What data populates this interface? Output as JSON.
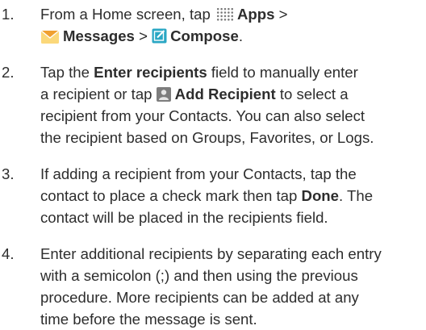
{
  "steps": [
    {
      "number": "1.",
      "lines": [
        [
          {
            "t": "text",
            "v": "From a Home screen, tap "
          },
          {
            "t": "icon",
            "icon": "apps-grid-icon"
          },
          {
            "t": "bold",
            "v": "Apps"
          },
          {
            "t": "text",
            "v": " >"
          }
        ],
        [
          {
            "t": "icon",
            "icon": "messages-envelope-icon"
          },
          {
            "t": "bold",
            "v": "Messages"
          },
          {
            "t": "text",
            "v": " > "
          },
          {
            "t": "icon",
            "icon": "compose-icon"
          },
          {
            "t": "bold",
            "v": "Compose"
          },
          {
            "t": "text",
            "v": "."
          }
        ]
      ]
    },
    {
      "number": "2.",
      "lines": [
        [
          {
            "t": "text",
            "v": "Tap the "
          },
          {
            "t": "bold",
            "v": "Enter recipients"
          },
          {
            "t": "text",
            "v": " field to manually enter"
          }
        ],
        [
          {
            "t": "text",
            "v": "a recipient or tap "
          },
          {
            "t": "icon",
            "icon": "add-recipient-icon"
          },
          {
            "t": "bold",
            "v": "Add Recipient"
          },
          {
            "t": "text",
            "v": " to select a"
          }
        ],
        [
          {
            "t": "text",
            "v": "recipient from your Contacts. You can also select"
          }
        ],
        [
          {
            "t": "text",
            "v": "the recipient based on Groups, Favorites, or Logs."
          }
        ]
      ]
    },
    {
      "number": "3.",
      "lines": [
        [
          {
            "t": "text",
            "v": "If adding a recipient from your Contacts, tap the"
          }
        ],
        [
          {
            "t": "text",
            "v": "contact to place a check mark then tap "
          },
          {
            "t": "bold",
            "v": "Done"
          },
          {
            "t": "text",
            "v": ". The"
          }
        ],
        [
          {
            "t": "text",
            "v": "contact will be placed in the recipients field."
          }
        ]
      ]
    },
    {
      "number": "4.",
      "lines": [
        [
          {
            "t": "text",
            "v": "Enter additional recipients by separating each entry"
          }
        ],
        [
          {
            "t": "text",
            "v": "with a semicolon (;) and then using the previous"
          }
        ],
        [
          {
            "t": "text",
            "v": "procedure. More recipients can be added at any"
          }
        ],
        [
          {
            "t": "text",
            "v": "time before the message is sent."
          }
        ]
      ]
    }
  ],
  "colors": {
    "text": "#2d2d2d",
    "envelope_orange": "#f0a030",
    "envelope_yellow": "#fbd87a",
    "compose_teal": "#2aa7c4",
    "person_gray": "#7d7d7d"
  }
}
